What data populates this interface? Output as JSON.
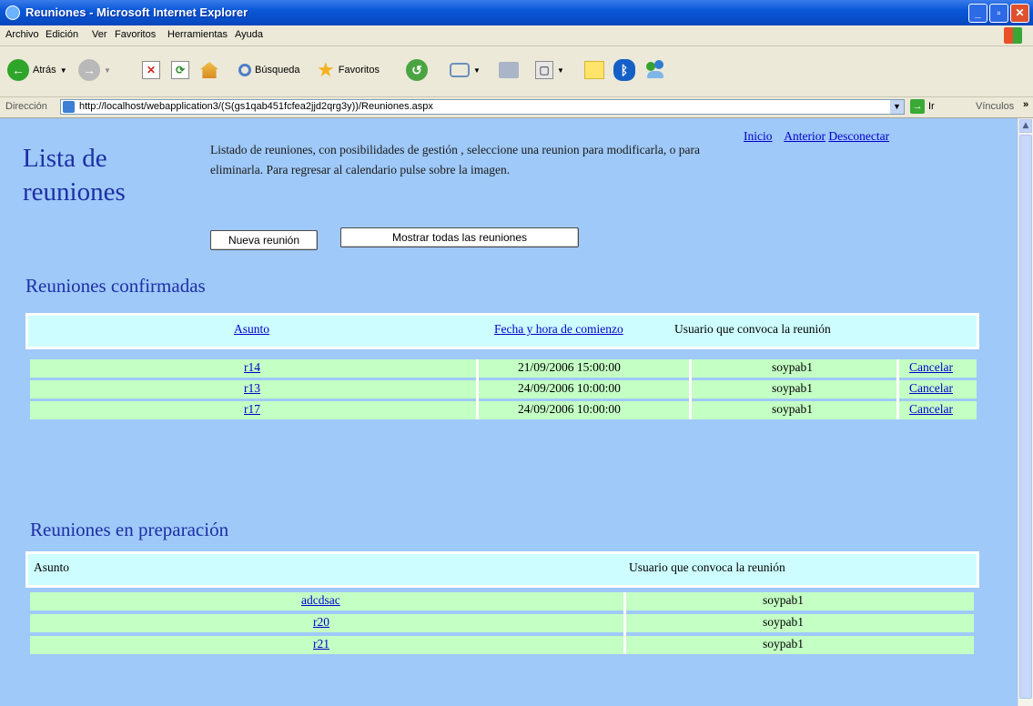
{
  "window": {
    "title": "Reuniones - Microsoft Internet Explorer"
  },
  "menu": [
    "Archivo",
    "Edición",
    "Ver",
    "Favoritos",
    "Herramientas",
    "Ayuda"
  ],
  "toolbar": {
    "back": "Atrás",
    "search": "Búsqueda",
    "favorites": "Favoritos"
  },
  "address": {
    "label": "Dirección",
    "url": "http://localhost/webapplication3/(S(gs1qab451fcfea2jjd2qrg3y))/Reuniones.aspx",
    "go": "Ir",
    "links": "Vínculos"
  },
  "page": {
    "title_line1": "Lista de",
    "title_line2": "reuniones",
    "description": "Listado de reuniones, con posibilidades de gestión , seleccione una reunion para modificarla, o para eliminarla. Para regresar al calendario pulse sobre la imagen.",
    "nav": {
      "home": "Inicio",
      "previous": "Anterior",
      "logout": "Desconectar"
    },
    "buttons": {
      "new_meeting": "Nueva reunión",
      "show_all": "Mostrar todas las reuniones"
    }
  },
  "confirmed": {
    "heading": "Reuniones confirmadas",
    "columns": [
      "Asunto",
      "Fecha y hora de comienzo",
      "Usuario que convoca la reunión"
    ],
    "rows": [
      {
        "subject": "r14",
        "start": "21/09/2006 15:00:00",
        "user": "soypab1",
        "action": "Cancelar"
      },
      {
        "subject": "r13",
        "start": "24/09/2006 10:00:00",
        "user": "soypab1",
        "action": "Cancelar"
      },
      {
        "subject": "r17",
        "start": "24/09/2006 10:00:00",
        "user": "soypab1",
        "action": "Cancelar"
      }
    ]
  },
  "preparing": {
    "heading": "Reuniones en preparación",
    "columns": [
      "Asunto",
      "Usuario que convoca la reunión"
    ],
    "rows": [
      {
        "subject": "adcdsac",
        "user": "soypab1"
      },
      {
        "subject": "r20",
        "user": "soypab1"
      },
      {
        "subject": "r21",
        "user": "soypab1"
      }
    ]
  }
}
